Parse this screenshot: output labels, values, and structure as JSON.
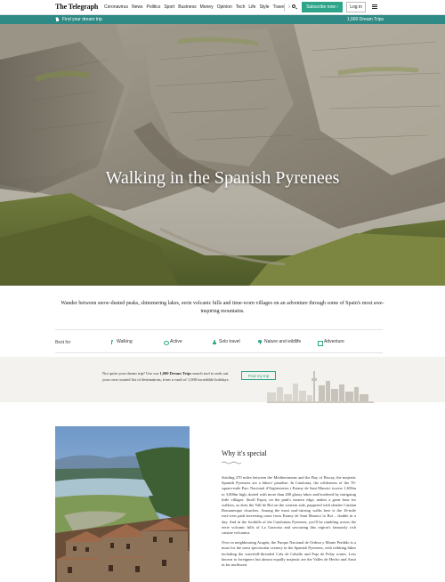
{
  "header": {
    "logo": "The Telegraph",
    "nav": [
      "Coronavirus",
      "News",
      "Politics",
      "Sport",
      "Business",
      "Money",
      "Opinion",
      "Tech",
      "Life",
      "Style",
      "Travel"
    ],
    "nav_more": "›",
    "subscribe_label": "Subscribe now ›",
    "login_label": "Log in"
  },
  "strip": {
    "breadcrumb": "Find your dream trip",
    "count": "1,000 Dream Trips"
  },
  "hero": {
    "title": "Walking in the Spanish Pyrenees"
  },
  "intro": "Wander between snow-dusted peaks, shimmering lakes, eerie volcanic hills and time-worn villages on an adventure through some of Spain's most awe-inspiring mountains.",
  "best_for": {
    "label": "Best for",
    "tags": [
      {
        "label": "Walking",
        "icon": "walking-icon"
      },
      {
        "label": "Active",
        "icon": "active-icon"
      },
      {
        "label": "Solo travel",
        "icon": "solo-travel-icon"
      },
      {
        "label": "Nature and wildlife",
        "icon": "nature-icon"
      },
      {
        "label": "Adventure",
        "icon": "adventure-icon"
      }
    ]
  },
  "promo": {
    "text_a": "Not quite your dream trip? Use our ",
    "text_b": "1,000 Dream Trips",
    "text_c": " search tool to seek out your own curated list of destinations, from a vault of 1,000 incredible holidays.",
    "button_label": "Find my trip"
  },
  "why": {
    "heading": "Why it's special",
    "paragraphs": [
      "Striding 270 miles between the Mediterranean and the Bay of Biscay, the majestic Spanish Pyrenees are a hikers' paradise. In Catalonia, the wilderness of the 70-square-mile Parc Nacional d'Aigüestortes i Estany de Sant Maurici towers 1,650m to 3,000m high, dotted with more than 200 glassy lakes and bordered by intriguing little villages. Stroll Espot, on the park's eastern edge, makes a great base for walkers, as does the Vall de Boí on the western side, peppered with slender Catalan Romanesque churches. Among the most soul-stirring walks here is the 16-mile east-west park-traversing route from Estany de Sant Maurici to Boí – doable in a day. And in the foothills of the Catalonian Pyrenees, you'll be rambling across the eerie volcanic hills of La Garrotxa and savouring this region's famously rich cuisine volcanica.",
      "Over in neighbouring Aragón, the Parque Nacional de Ordesa y Monte Perdido is a must for the most spectacular scenery in the Spanish Pyrenees, with trekking hikes including the waterfall-threaded Cola de Caballo and Faja de Pelay routes. Less known to foreigners but almost equally majestic are the Valles de Hecho and Ansó in far northwest"
    ]
  },
  "colors": {
    "accent": "#2ea58a",
    "strip": "#2f8a86",
    "promo_bg": "#f3f2ee"
  }
}
